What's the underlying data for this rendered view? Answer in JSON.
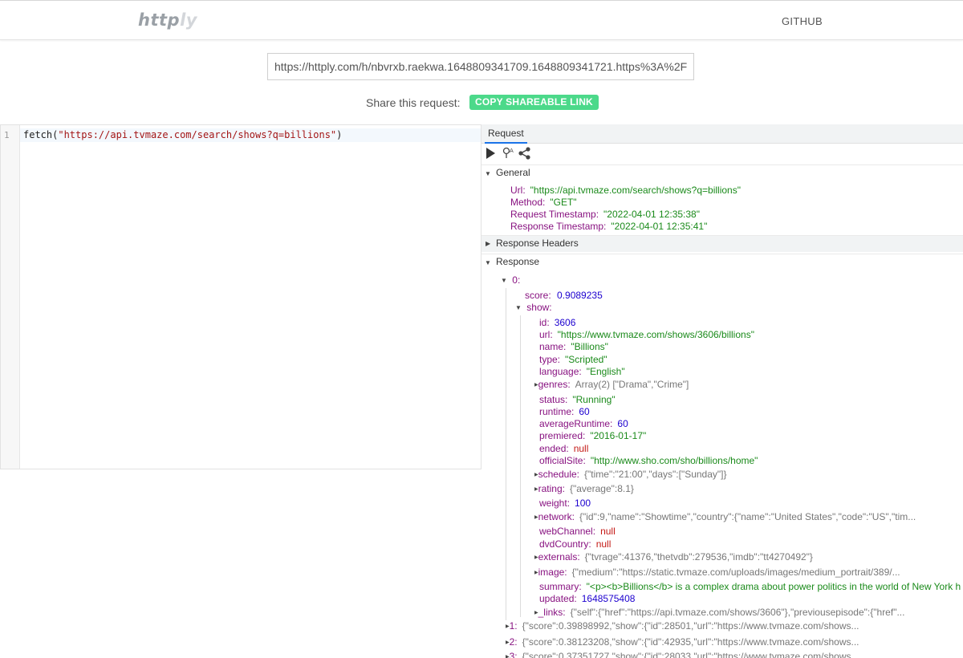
{
  "app": {
    "logo_part1": "http",
    "logo_part2": "ly",
    "github_label": "GITHUB"
  },
  "url_bar": {
    "value": "https://httply.com/h/nbvrxb.raekwa.1648809341709.1648809341721.https%3A%2F"
  },
  "share": {
    "label": "Share this request:",
    "button": "COPY SHAREABLE LINK"
  },
  "editor": {
    "line_number": "1",
    "code_fn": "fetch(",
    "code_str": "\"https://api.tvmaze.com/search/shows?q=billions\"",
    "code_end": ")"
  },
  "panel": {
    "tab_label": "Request",
    "general": {
      "label": "General",
      "fields": [
        {
          "key": "Url:",
          "value": "\"https://api.tvmaze.com/search/shows?q=billions\""
        },
        {
          "key": "Method:",
          "value": "\"GET\""
        },
        {
          "key": "Request Timestamp:",
          "value": "\"2022-04-01 12:35:38\""
        },
        {
          "key": "Response Timestamp:",
          "value": "\"2022-04-01 12:35:41\""
        }
      ]
    },
    "response_headers_label": "Response Headers",
    "response_label": "Response",
    "item0_label": "0:",
    "score": {
      "key": "score:",
      "value": "0.9089235"
    },
    "show_label": "show:",
    "show_fields": [
      {
        "key": "id:",
        "value": "3606",
        "type": "num",
        "expandable": false
      },
      {
        "key": "url:",
        "value": "\"https://www.tvmaze.com/shows/3606/billions\"",
        "type": "str",
        "expandable": false
      },
      {
        "key": "name:",
        "value": "\"Billions\"",
        "type": "str",
        "expandable": false
      },
      {
        "key": "type:",
        "value": "\"Scripted\"",
        "type": "str",
        "expandable": false
      },
      {
        "key": "language:",
        "value": "\"English\"",
        "type": "str",
        "expandable": false
      },
      {
        "key": "genres:",
        "value": "Array(2) [\"Drama\",\"Crime\"]",
        "type": "dim",
        "expandable": true
      },
      {
        "key": "status:",
        "value": "\"Running\"",
        "type": "str",
        "expandable": false
      },
      {
        "key": "runtime:",
        "value": "60",
        "type": "num",
        "expandable": false
      },
      {
        "key": "averageRuntime:",
        "value": "60",
        "type": "num",
        "expandable": false
      },
      {
        "key": "premiered:",
        "value": "\"2016-01-17\"",
        "type": "str",
        "expandable": false
      },
      {
        "key": "ended:",
        "value": "null",
        "type": "null",
        "expandable": false
      },
      {
        "key": "officialSite:",
        "value": "\"http://www.sho.com/sho/billions/home\"",
        "type": "str",
        "expandable": false
      },
      {
        "key": "schedule:",
        "value": "{\"time\":\"21:00\",\"days\":[\"Sunday\"]}",
        "type": "dim",
        "expandable": true
      },
      {
        "key": "rating:",
        "value": "{\"average\":8.1}",
        "type": "dim",
        "expandable": true
      },
      {
        "key": "weight:",
        "value": "100",
        "type": "num",
        "expandable": false
      },
      {
        "key": "network:",
        "value": "{\"id\":9,\"name\":\"Showtime\",\"country\":{\"name\":\"United States\",\"code\":\"US\",\"tim...",
        "type": "dim",
        "expandable": true
      },
      {
        "key": "webChannel:",
        "value": "null",
        "type": "null",
        "expandable": false
      },
      {
        "key": "dvdCountry:",
        "value": "null",
        "type": "null",
        "expandable": false
      },
      {
        "key": "externals:",
        "value": "{\"tvrage\":41376,\"thetvdb\":279536,\"imdb\":\"tt4270492\"}",
        "type": "dim",
        "expandable": true
      },
      {
        "key": "image:",
        "value": "{\"medium\":\"https://static.tvmaze.com/uploads/images/medium_portrait/389/...",
        "type": "dim",
        "expandable": true
      },
      {
        "key": "summary:",
        "value": "\"<p><b>Billions</b> is a complex drama about power politics in the world of New York h",
        "type": "str",
        "expandable": false
      },
      {
        "key": "updated:",
        "value": "1648575408",
        "type": "num",
        "expandable": false
      },
      {
        "key": "_links:",
        "value": "{\"self\":{\"href\":\"https://api.tvmaze.com/shows/3606\"},\"previousepisode\":{\"href\"...",
        "type": "dim",
        "expandable": true
      }
    ],
    "more_items": [
      {
        "key": "1:",
        "value": "{\"score\":0.39898992,\"show\":{\"id\":28501,\"url\":\"https://www.tvmaze.com/shows..."
      },
      {
        "key": "2:",
        "value": "{\"score\":0.38123208,\"show\":{\"id\":42935,\"url\":\"https://www.tvmaze.com/shows..."
      },
      {
        "key": "3:",
        "value": "{\"score\":0.37351727,\"show\":{\"id\":28033,\"url\":\"https://www.tvmaze.com/shows..."
      }
    ]
  }
}
